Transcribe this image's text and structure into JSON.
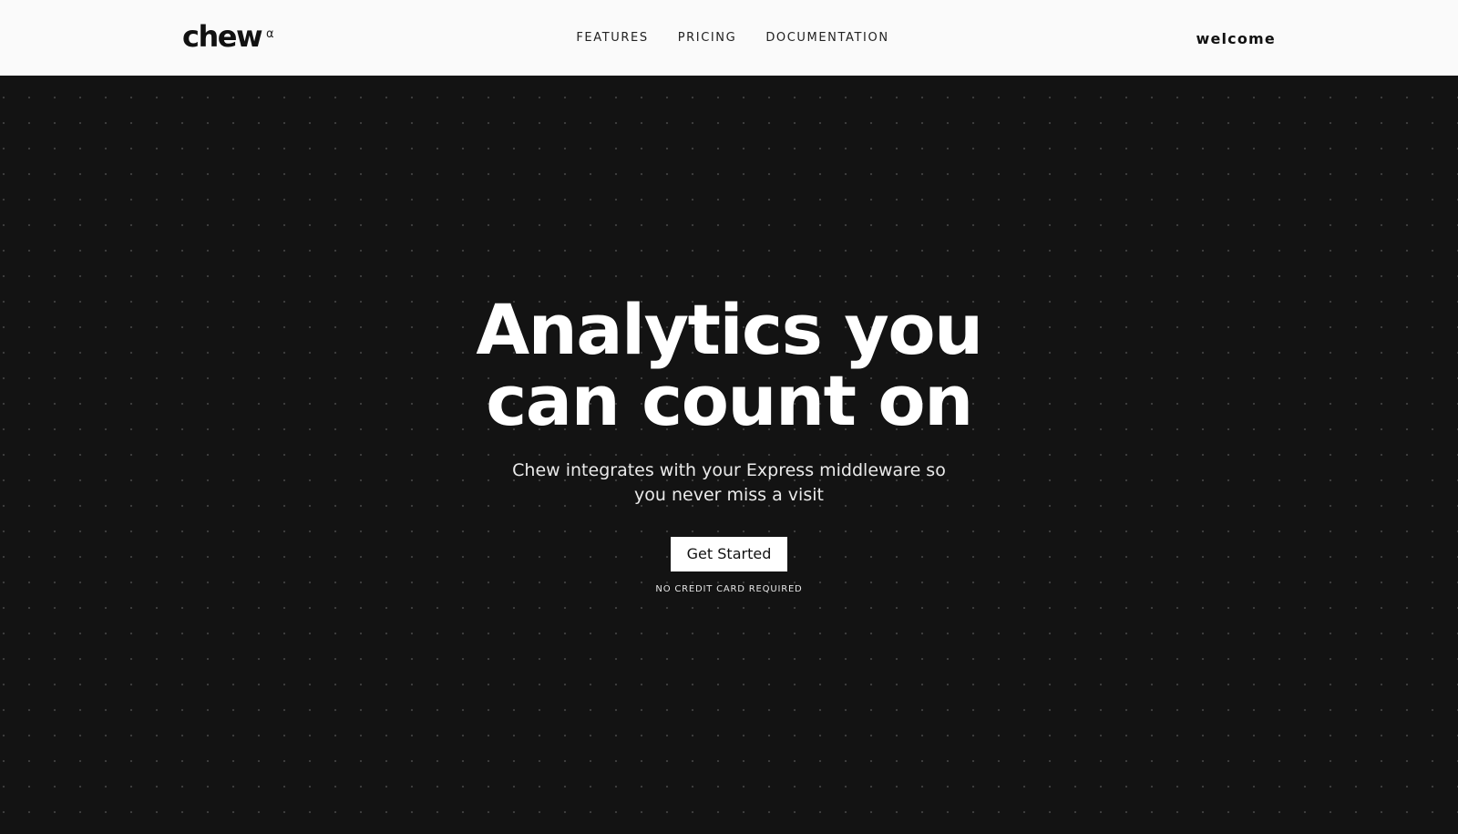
{
  "header": {
    "logo_text": "chew",
    "logo_mark": "α",
    "nav": [
      {
        "label": "FEATURES"
      },
      {
        "label": "PRICING"
      },
      {
        "label": "DOCUMENTATION"
      }
    ],
    "account_link": "welcome"
  },
  "hero": {
    "headline": "Analytics you can count on",
    "subheadline": "Chew integrates with your Express middleware so you never miss a visit",
    "cta_label": "Get Started",
    "cta_note": "NO CREDIT CARD REQUIRED"
  },
  "colors": {
    "header_bg": "#fafafa",
    "hero_bg": "#131313",
    "text_light": "#ffffff",
    "text_dark": "#111111"
  }
}
